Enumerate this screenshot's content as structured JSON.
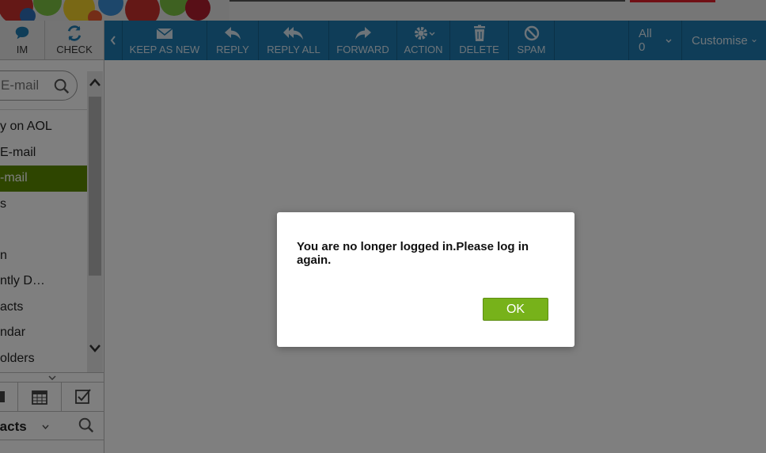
{
  "left_top": {
    "im_label": "IM",
    "check_label": "CHECK"
  },
  "sidebar": {
    "search_placeholder": "E-mail",
    "items": [
      {
        "label": "y on AOL"
      },
      {
        "label": "E-mail"
      },
      {
        "label": "-mail"
      },
      {
        "label": "s"
      },
      {
        "label": ""
      },
      {
        "label": "n"
      },
      {
        "label": "ntly D…"
      },
      {
        "label": "acts"
      },
      {
        "label": "ndar"
      },
      {
        "label": "olders"
      }
    ],
    "contacts_label": "tacts"
  },
  "toolbar": {
    "keep_as_new": "KEEP AS NEW",
    "reply": "REPLY",
    "reply_all": "REPLY ALL",
    "forward": "FORWARD",
    "action": "ACTION",
    "delete": "DELETE",
    "spam": "SPAM",
    "all_count": "All 0",
    "customise": "Customise"
  },
  "modal": {
    "message": "You are no longer logged in.Please log in again.",
    "ok_label": "OK"
  },
  "colors": {
    "toolbar": "#1f7bb0",
    "active_folder": "#5c8a00",
    "ok_button": "#77b21a"
  }
}
